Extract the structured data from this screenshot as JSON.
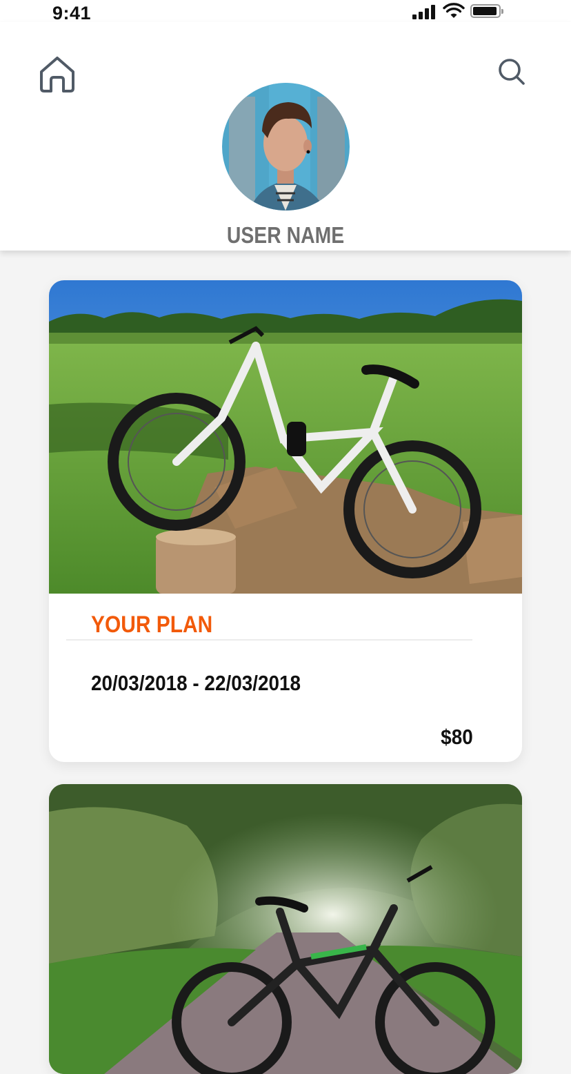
{
  "status_bar": {
    "time": "9:41"
  },
  "header": {
    "home_icon": "home-icon",
    "search_icon": "search-icon",
    "user_name": "USER NAME"
  },
  "cards": [
    {
      "label": "YOUR PLAN",
      "dates": "20/03/2018 - 22/03/2018",
      "price": "$80"
    },
    {}
  ],
  "colors": {
    "accent": "#f25a0a",
    "username": "#6f6f6f",
    "text": "#111111",
    "background": "#f4f4f4"
  }
}
